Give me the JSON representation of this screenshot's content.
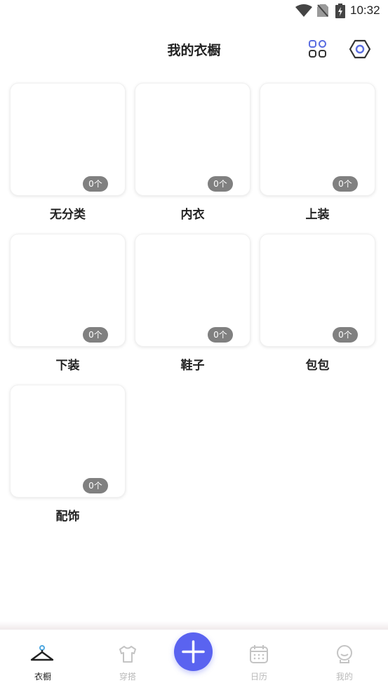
{
  "status_bar": {
    "time": "10:32"
  },
  "header": {
    "title": "我的衣橱"
  },
  "categories": [
    {
      "name": "无分类",
      "count": "0个"
    },
    {
      "name": "内衣",
      "count": "0个"
    },
    {
      "name": "上装",
      "count": "0个"
    },
    {
      "name": "下装",
      "count": "0个"
    },
    {
      "name": "鞋子",
      "count": "0个"
    },
    {
      "name": "包包",
      "count": "0个"
    },
    {
      "name": "配饰",
      "count": "0个"
    }
  ],
  "tabs": [
    {
      "label": "衣橱",
      "icon": "hanger-icon",
      "active": true
    },
    {
      "label": "穿搭",
      "icon": "shirt-icon",
      "active": false
    },
    {
      "label": "日历",
      "icon": "calendar-icon",
      "active": false
    },
    {
      "label": "我的",
      "icon": "user-icon",
      "active": false
    }
  ],
  "colors": {
    "accent": "#5a63f0",
    "badge": "#808080",
    "icon_blue": "#5b6ee1",
    "inactive": "#b9b9b9"
  }
}
